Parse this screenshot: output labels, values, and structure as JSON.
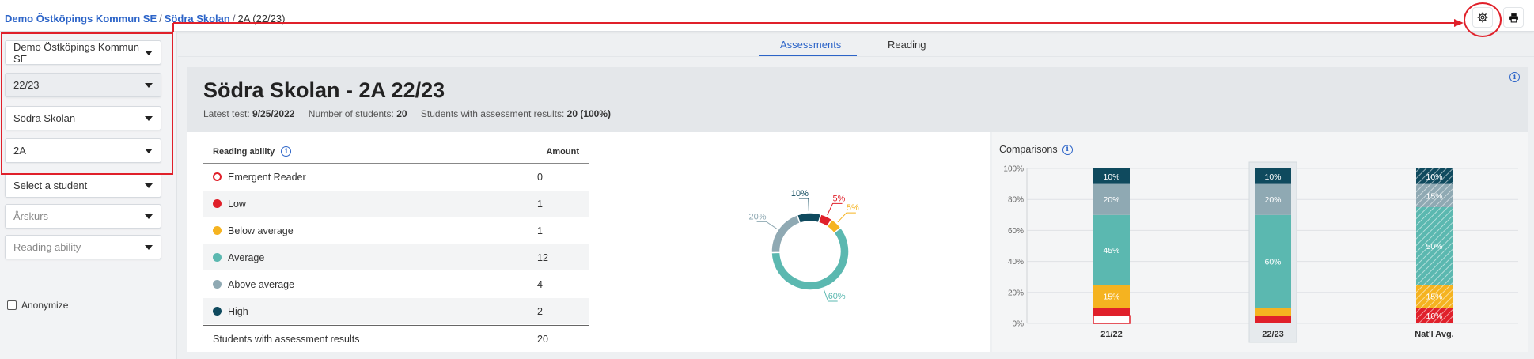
{
  "breadcrumb": {
    "org": "Demo Östköpings Kommun SE",
    "school": "Södra Skolan",
    "current": "2A (22/23)"
  },
  "toolbar": {
    "settings_icon": "gear-icon",
    "print_icon": "printer-icon"
  },
  "sidebar": {
    "municipality": "Demo Östköpings Kommun SE",
    "year": "22/23",
    "school": "Södra Skolan",
    "class": "2A",
    "student_placeholder": "Select a student",
    "grade_placeholder": "Årskurs",
    "ability_placeholder": "Reading ability",
    "anonymize": "Anonymize"
  },
  "tabs": [
    {
      "label": "Assessments",
      "active": true
    },
    {
      "label": "Reading",
      "active": false
    }
  ],
  "header": {
    "title": "Södra Skolan - 2A 22/23",
    "latest_test_label": "Latest test:",
    "latest_test": "9/25/2022",
    "students_label": "Number of students:",
    "students": "20",
    "results_label": "Students with assessment results:",
    "results": "20 (100%)"
  },
  "table": {
    "col_ability": "Reading ability",
    "col_amount": "Amount",
    "rows": [
      {
        "label": "Emergent Reader",
        "amount": "0",
        "color": "#e0202a",
        "hollow": true
      },
      {
        "label": "Low",
        "amount": "1",
        "color": "#e0202a",
        "hollow": false
      },
      {
        "label": "Below average",
        "amount": "1",
        "color": "#f5b320",
        "hollow": false
      },
      {
        "label": "Average",
        "amount": "12",
        "color": "#5bb8b0",
        "hollow": false
      },
      {
        "label": "Above average",
        "amount": "4",
        "color": "#8fa9b3",
        "hollow": false
      },
      {
        "label": "High",
        "amount": "2",
        "color": "#0f4a5e",
        "hollow": false
      }
    ],
    "footer_label": "Students with assessment results",
    "footer_amount": "20"
  },
  "chart_data": [
    {
      "type": "pie",
      "categories": [
        "High",
        "Low",
        "Below average",
        "Average",
        "Above average"
      ],
      "values": [
        10,
        5,
        5,
        60,
        20
      ],
      "labels": [
        "10%",
        "5%",
        "5%",
        "60%",
        "20%"
      ],
      "colors": [
        "#0f4a5e",
        "#e0202a",
        "#f5b320",
        "#5bb8b0",
        "#8fa9b3"
      ]
    },
    {
      "type": "bar",
      "title": "Comparisons",
      "categories": [
        "21/22",
        "22/23",
        "Nat'l Avg."
      ],
      "ylim": [
        0,
        100
      ],
      "yticks": [
        "0%",
        "20%",
        "40%",
        "60%",
        "80%",
        "100%"
      ],
      "series": [
        {
          "name": "Emergent Reader",
          "color": "#e0202a",
          "values": [
            5,
            0,
            0
          ]
        },
        {
          "name": "Low",
          "color": "#e0202a",
          "values": [
            5,
            5,
            10
          ]
        },
        {
          "name": "Below average",
          "color": "#f5b320",
          "values": [
            15,
            5,
            15
          ]
        },
        {
          "name": "Average",
          "color": "#5bb8b0",
          "values": [
            45,
            60,
            50
          ]
        },
        {
          "name": "Above average",
          "color": "#8fa9b3",
          "values": [
            20,
            20,
            15
          ]
        },
        {
          "name": "High",
          "color": "#0f4a5e",
          "values": [
            10,
            10,
            10
          ]
        }
      ],
      "segment_labels": [
        [
          "",
          "",
          "15%",
          "45%",
          "20%",
          "10%"
        ],
        [
          "",
          "",
          "",
          "60%",
          "20%",
          "10%"
        ],
        [
          "",
          "10%",
          "15%",
          "50%",
          "15%",
          "10%"
        ]
      ],
      "highlighted": "22/23",
      "hatched": "Nat'l Avg."
    }
  ]
}
